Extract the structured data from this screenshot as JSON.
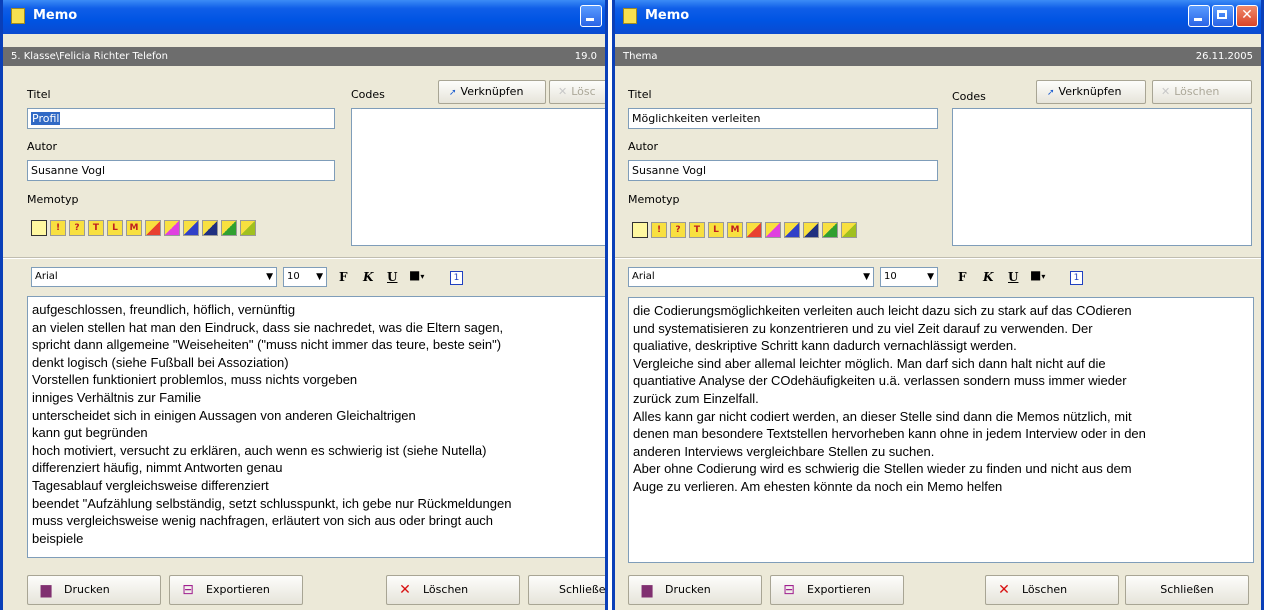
{
  "colors": {
    "titlebar": "#0054e3",
    "subheader": "#6d6d6d",
    "selection": "#316ac5"
  },
  "left": {
    "title": "Memo",
    "subheader_left": "5. Klasse\\Felicia Richter Telefon",
    "subheader_right": "19.0",
    "titel_label": "Titel",
    "titel_value": "Profil",
    "autor_label": "Autor",
    "autor_value": "Susanne Vogl",
    "memotyp_label": "Memotyp",
    "codes_label": "Codes",
    "link_button": "Verknüpfen",
    "delete_code_button": "Lösc",
    "font_name": "Arial",
    "font_size": "10",
    "bold_label": "F",
    "italic_label": "K",
    "underline_label": "U",
    "text_lines": [
      "aufgeschlossen, freundlich, höflich, vernünftig",
      "an vielen stellen hat man den Eindruck, dass sie nachredet, was die Eltern sagen,",
      "spricht dann allgemeine \"Weiseheiten\" (\"muss nicht immer das teure, beste sein\")",
      "denkt logisch (siehe Fußball bei Assoziation)",
      "Vorstellen funktioniert problemlos, muss nichts vorgeben",
      "inniges Verhältnis zur Familie",
      "unterscheidet sich in einigen Aussagen von anderen Gleichaltrigen",
      "kann gut begründen",
      "hoch motiviert, versucht zu erklären, auch wenn es schwierig ist (siehe Nutella)",
      "differenziert häufig, nimmt Antworten genau",
      "Tagesablauf vergleichsweise differenziert",
      "beendet \"Aufzählung selbständig, setzt schlusspunkt, ich gebe nur Rückmeldungen",
      "muss vergleichsweise wenig nachfragen, erläutert von sich aus oder bringt auch",
      "beispiele"
    ],
    "print_button": "Drucken",
    "export_button": "Exportieren",
    "delete_button": "Löschen",
    "close_button": "Schließen"
  },
  "right": {
    "title": "Memo",
    "subheader_left": "Thema",
    "subheader_right": "26.11.2005",
    "titel_label": "Titel",
    "titel_value": "Möglichkeiten verleiten",
    "autor_label": "Autor",
    "autor_value": "Susanne Vogl",
    "memotyp_label": "Memotyp",
    "codes_label": "Codes",
    "link_button": "Verknüpfen",
    "delete_code_button": "Löschen",
    "font_name": "Arial",
    "font_size": "10",
    "bold_label": "F",
    "italic_label": "K",
    "underline_label": "U",
    "text_lines": [
      "die Codierungsmöglichkeiten verleiten auch leicht dazu sich zu stark auf das COdieren",
      "und systematisieren zu konzentrieren und zu viel Zeit darauf zu verwenden. Der",
      "qualiative, deskriptive Schritt kann dadurch vernachlässigt werden.",
      "Vergleiche sind aber allemal leichter möglich. Man darf sich dann halt nicht auf die",
      "quantiative Analyse der COdehäufigkeiten u.ä. verlassen sondern muss immer wieder",
      "zurück zum Einzelfall.",
      "Alles kann gar nicht codiert werden, an dieser Stelle sind dann die Memos nützlich, mit",
      "denen man besondere Textstellen hervorheben kann ohne in jedem Interview oder in den",
      "anderen Interviews vergleichbare Stellen zu suchen.",
      "Aber ohne Codierung wird es schwierig die Stellen wieder zu finden und nicht aus dem",
      "Auge zu verlieren. Am ehesten könnte da noch ein Memo helfen"
    ],
    "print_button": "Drucken",
    "export_button": "Exportieren",
    "delete_button": "Löschen",
    "close_button": "Schließen"
  },
  "memotype_icons": [
    {
      "glyph": "",
      "color": "#f8f070"
    },
    {
      "glyph": "!",
      "color": "#f8e040"
    },
    {
      "glyph": "?",
      "color": "#f8e040"
    },
    {
      "glyph": "T",
      "color": "#f8e040"
    },
    {
      "glyph": "L",
      "color": "#f8e040"
    },
    {
      "glyph": "M",
      "color": "#f8e040"
    },
    {
      "glyph": "",
      "color": "#e84030"
    },
    {
      "glyph": "",
      "color": "#e040e0"
    },
    {
      "glyph": "",
      "color": "#3040c8"
    },
    {
      "glyph": "",
      "color": "#203080"
    },
    {
      "glyph": "",
      "color": "#30a030"
    },
    {
      "glyph": "",
      "color": "#a0c020"
    }
  ]
}
